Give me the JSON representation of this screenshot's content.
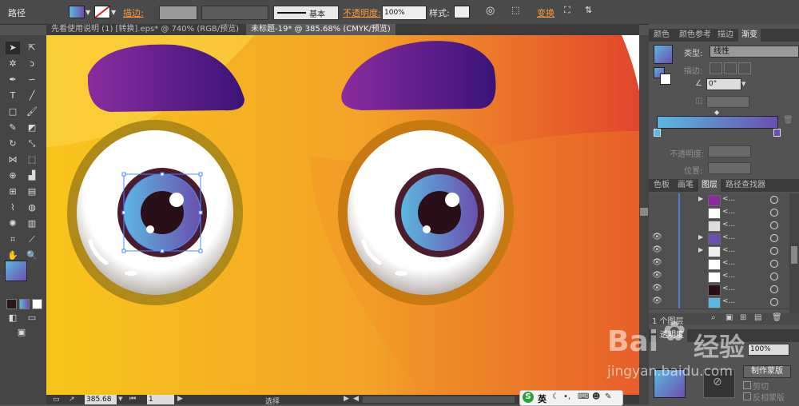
{
  "control_bar": {
    "object_type": "路径",
    "stroke_label": "描边:",
    "basic_label": "基本",
    "opacity_label": "不透明度:",
    "opacity_value": "100%",
    "style_label": "样式:",
    "transform_label": "变换"
  },
  "documents": {
    "tab1": "先看使用说明 (1) [转换].eps* @ 740% (RGB/预览)",
    "tab2": "未标题-19* @ 385.68% (CMYK/预览)"
  },
  "status_bar": {
    "zoom": "385.68",
    "artboard": "1",
    "mode": "选择"
  },
  "gradient_panel": {
    "tabs": [
      "颜色",
      "颜色参考",
      "描边",
      "渐变"
    ],
    "type_label": "类型:",
    "type_value": "线性",
    "stroke_label": "描边:",
    "angle_value": "0°",
    "opacity_label": "不透明度:",
    "position_label": "位置:",
    "colors": {
      "start": "#5bb8e0",
      "end": "#6a4fb0"
    }
  },
  "layers_panel": {
    "tabs": [
      "色板",
      "画笔",
      "图层",
      "路径查找器"
    ],
    "count": "1 个图层",
    "row_name": "<...",
    "rows": 10
  },
  "transparency_panel": {
    "tab": "透明度",
    "value": "100%",
    "make_mask": "制作蒙版",
    "clip": "剪切",
    "invert": "反相蒙版"
  },
  "ime": {
    "lang": "英"
  },
  "watermark": {
    "brand": "Bai",
    "brand2": "经验",
    "url": "jingyan.baidu.com"
  }
}
